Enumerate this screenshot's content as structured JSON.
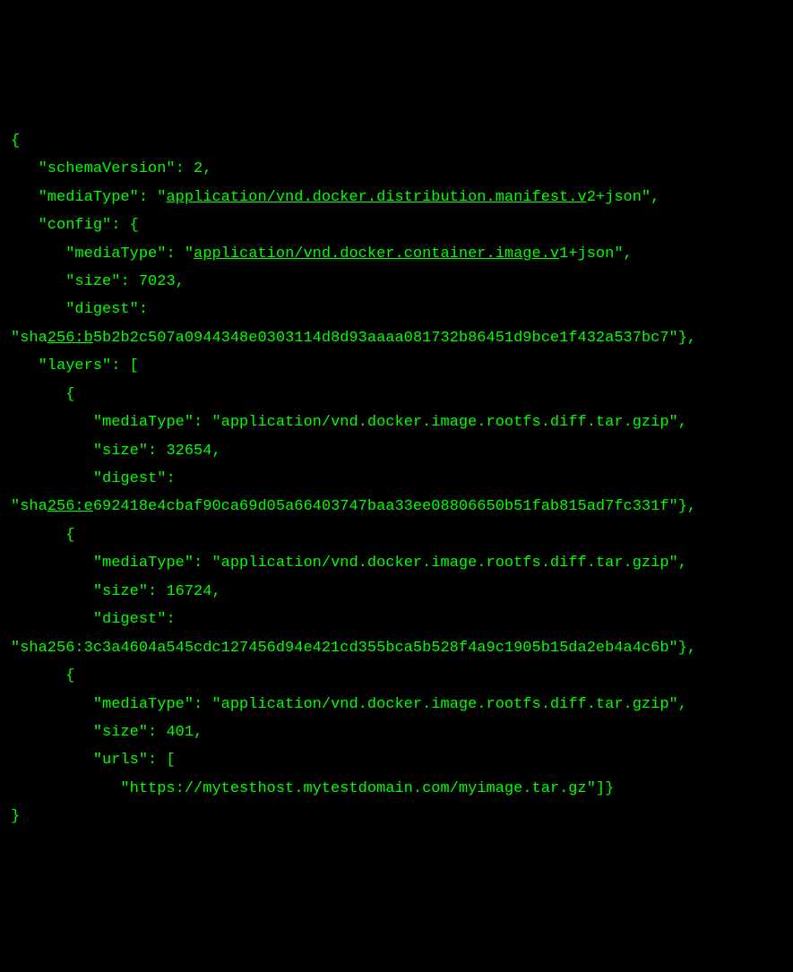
{
  "code": {
    "l01": "{",
    "l02_indent": "   ",
    "l02_key": "\"schemaVersion\"",
    "l02_sep": ": ",
    "l02_val": "2",
    "l02_end": ",",
    "l03_indent": "   ",
    "l03_key": "\"mediaType\"",
    "l03_sep": ": ",
    "l03_q1": "\"",
    "l03_ul": "application/vnd.docker.distribution.manifest.v",
    "l03_rest": "2+json\",",
    "l04_indent": "   ",
    "l04_key": "\"config\"",
    "l04_sep": ": {",
    "l05_indent": "      ",
    "l05_key": "\"mediaType\"",
    "l05_sep": ": ",
    "l05_q1": "\"",
    "l05_ul": "application/vnd.docker.container.image.v",
    "l05_rest": "1+json\",",
    "l06_indent": "      ",
    "l06_key": "\"size\"",
    "l06_sep": ": ",
    "l06_val": "7023",
    "l06_end": ",",
    "l07_indent": "      ",
    "l07_key": "\"digest\"",
    "l07_sep": ":",
    "l08_pre": "\"sha",
    "l08_ul": "256:b",
    "l08_rest": "5b2b2c507a0944348e0303114d8d93aaaa081732b86451d9bce1f432a537bc7\"},",
    "l09_indent": "   ",
    "l09_key": "\"layers\"",
    "l09_sep": ": [",
    "l10_indent": "      ",
    "l10_val": "{",
    "l11_indent": "         ",
    "l11_key": "\"mediaType\"",
    "l11_sep": ": ",
    "l11_val": "\"application/vnd.docker.image.rootfs.diff.tar.gzip\",",
    "l12_indent": "         ",
    "l12_key": "\"size\"",
    "l12_sep": ": ",
    "l12_val": "32654",
    "l12_end": ",",
    "l13_indent": "         ",
    "l13_key": "\"digest\"",
    "l13_sep": ":",
    "l14_pre": "\"sha",
    "l14_ul": "256:e",
    "l14_rest": "692418e4cbaf90ca69d05a66403747baa33ee08806650b51fab815ad7fc331f\"},",
    "l15_indent": "      ",
    "l15_val": "{",
    "l16_indent": "         ",
    "l16_key": "\"mediaType\"",
    "l16_sep": ": ",
    "l16_val": "\"application/vnd.docker.image.rootfs.diff.tar.gzip\",",
    "l17_indent": "         ",
    "l17_key": "\"size\"",
    "l17_sep": ": ",
    "l17_val": "16724",
    "l17_end": ",",
    "l18_indent": "         ",
    "l18_key": "\"digest\"",
    "l18_sep": ":",
    "l19_val": "\"sha256:3c3a4604a545cdc127456d94e421cd355bca5b528f4a9c1905b15da2eb4a4c6b\"},",
    "l20_indent": "      ",
    "l20_val": "{",
    "l21_indent": "         ",
    "l21_key": "\"mediaType\"",
    "l21_sep": ": ",
    "l21_val": "\"application/vnd.docker.image.rootfs.diff.tar.gzip\",",
    "l22_indent": "         ",
    "l22_key": "\"size\"",
    "l22_sep": ": ",
    "l22_val": "401",
    "l22_end": ",",
    "l23_indent": "         ",
    "l23_key": "\"urls\"",
    "l23_sep": ": [",
    "l24_indent": "            ",
    "l24_val": "\"https://mytesthost.mytestdomain.com/myimage.tar.gz\"]}",
    "l25": "}"
  }
}
